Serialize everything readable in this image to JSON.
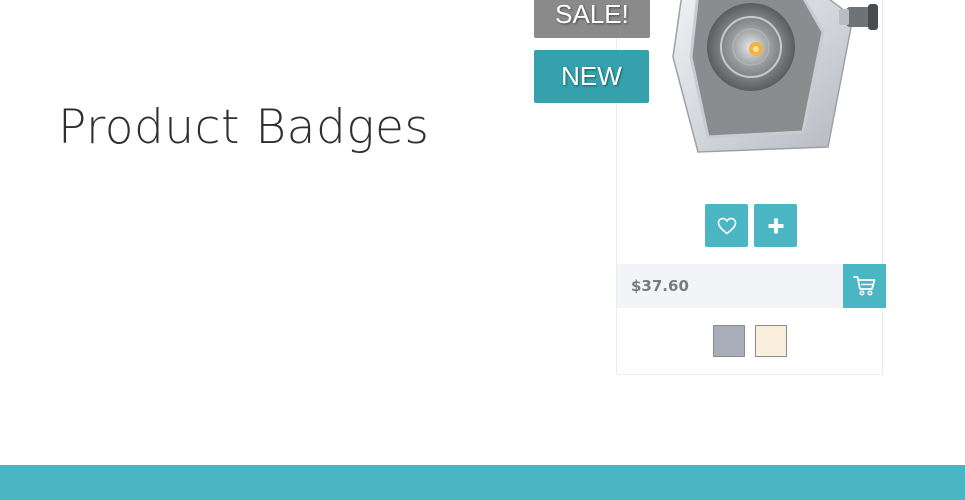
{
  "heading": "Product Badges",
  "badges": {
    "sale": "SALE!",
    "new": "NEW"
  },
  "product": {
    "image_icon": "floodlight-image",
    "price": "$37.60",
    "actions": {
      "wishlist_icon": "heart-icon",
      "add_icon": "plus-icon",
      "cart_icon": "cart-icon"
    },
    "swatches": [
      {
        "color": "#a8aeb9"
      },
      {
        "color": "#faeedd"
      }
    ]
  },
  "colors": {
    "accent": "#4ab6c4",
    "new_badge": "#35a1ad",
    "sale_badge": "#8a8a8a",
    "price_bar": "#f3f4f7",
    "footer": "#4ab6c4"
  }
}
